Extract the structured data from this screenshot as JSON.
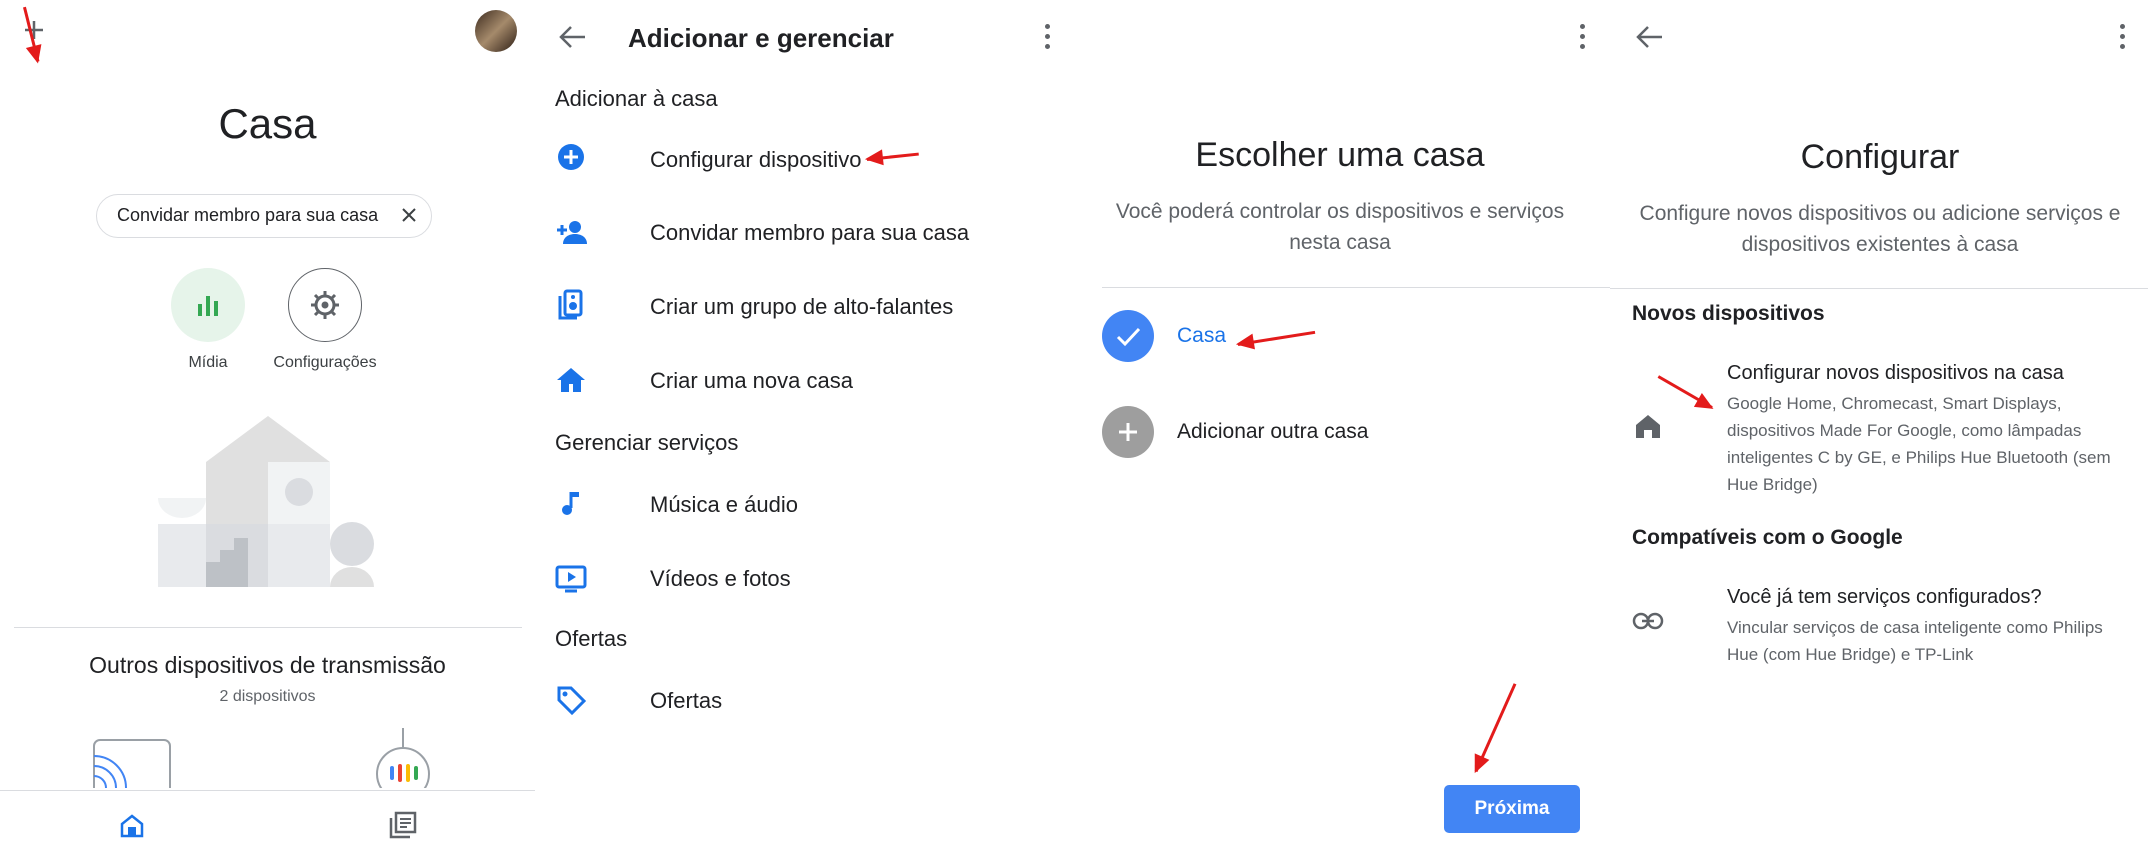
{
  "panel1": {
    "title": "Casa",
    "invite_chip": "Convidar membro para sua casa",
    "media_label": "Mídia",
    "settings_label": "Configurações",
    "other_devices_title": "Outros dispositivos de transmissão",
    "other_devices_count": "2 dispositivos"
  },
  "panel2": {
    "title": "Adicionar e gerenciar",
    "section_add": "Adicionar à casa",
    "items_add": [
      {
        "label": "Configurar dispositivo",
        "icon": "add-circle-icon"
      },
      {
        "label": "Convidar membro para sua casa",
        "icon": "person-add-icon"
      },
      {
        "label": "Criar um grupo de alto-falantes",
        "icon": "speaker-group-icon"
      },
      {
        "label": "Criar uma nova casa",
        "icon": "home-icon"
      }
    ],
    "section_services": "Gerenciar serviços",
    "items_services": [
      {
        "label": "Música e áudio",
        "icon": "music-note-icon"
      },
      {
        "label": "Vídeos e fotos",
        "icon": "video-icon"
      }
    ],
    "section_offers": "Ofertas",
    "items_offers": [
      {
        "label": "Ofertas",
        "icon": "tag-icon"
      }
    ]
  },
  "panel3": {
    "title": "Escolher uma casa",
    "subtitle": "Você poderá controlar os dispositivos e serviços nesta casa",
    "option_home": "Casa",
    "option_add": "Adicionar outra casa",
    "next_button": "Próxima"
  },
  "panel4": {
    "title": "Configurar",
    "subtitle": "Configure novos dispositivos ou adicione serviços e dispositivos existentes à casa",
    "section_new": "Novos dispositivos",
    "new_item_title": "Configurar novos dispositivos na casa",
    "new_item_desc": "Google Home, Chromecast, Smart Displays, dispositivos Made For Google, como lâmpadas inteligentes C by GE, e Philips Hue Bluetooth (sem Hue Bridge)",
    "section_compat": "Compatíveis com o Google",
    "compat_item_title": "Você já tem serviços configurados?",
    "compat_item_desc": "Vincular serviços de casa inteligente como Philips Hue (com Hue Bridge) e TP-Link"
  },
  "colors": {
    "accent": "#1a73e8",
    "arrow": "#e31b1b",
    "next_button_bg": "#4285f4",
    "selected_text": "#1a73e8"
  }
}
